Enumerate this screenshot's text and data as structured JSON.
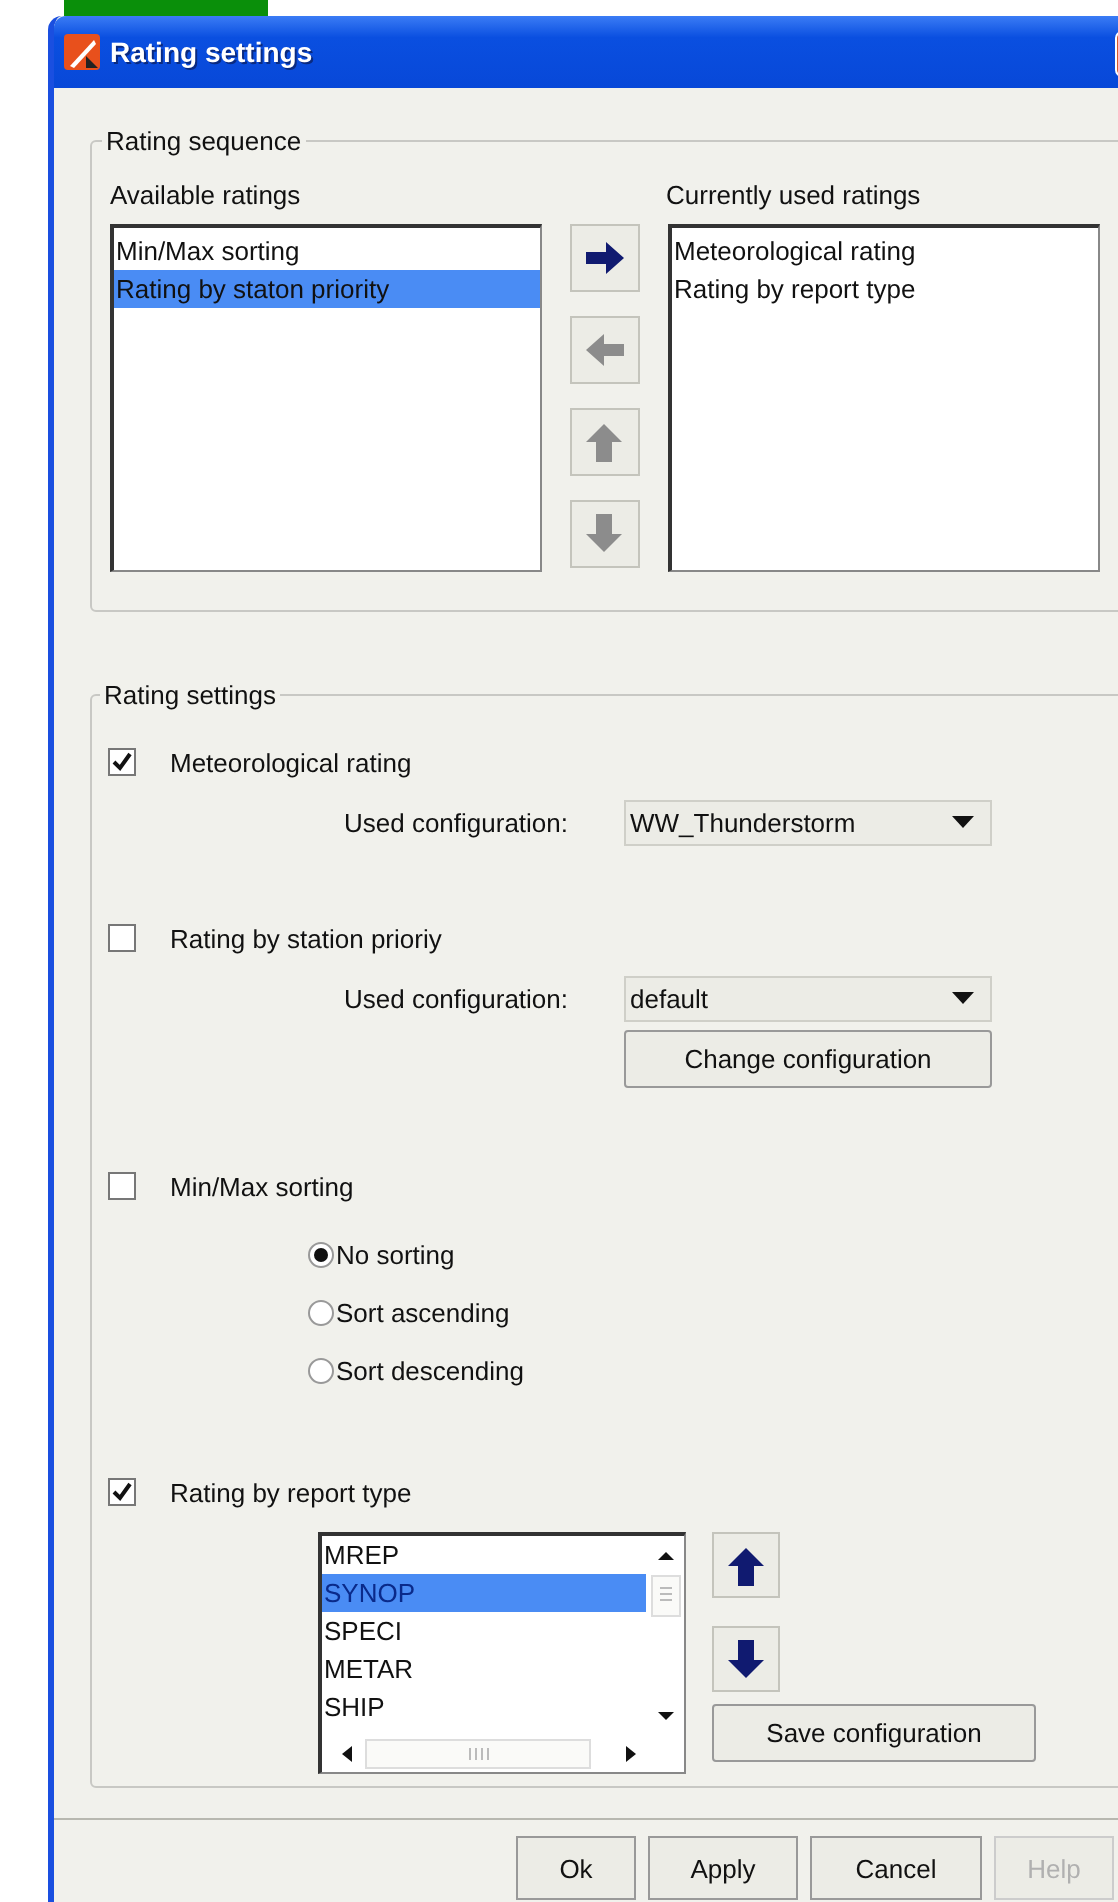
{
  "window": {
    "title": "Rating settings"
  },
  "rating_sequence": {
    "legend": "Rating sequence",
    "available_label": "Available ratings",
    "current_label": "Currently used ratings",
    "available": [
      {
        "label": "Min/Max sorting",
        "selected": false
      },
      {
        "label": "Rating by staton priority",
        "selected": true
      }
    ],
    "move_buttons": [
      {
        "kind": "right",
        "disabled": false
      },
      {
        "kind": "left",
        "disabled": true
      },
      {
        "kind": "up",
        "disabled": true
      },
      {
        "kind": "down",
        "disabled": true
      }
    ],
    "current": [
      {
        "label": "Meteorological rating",
        "selected": false
      },
      {
        "label": "Rating by report type",
        "selected": false
      }
    ]
  },
  "rating_settings": {
    "legend": "Rating settings",
    "options": [
      {
        "kind": "config",
        "label": "Meteorological rating",
        "checked": true,
        "config_label": "Used configuration:",
        "config_value": "WW_Thunderstorm"
      },
      {
        "kind": "config",
        "label": "Rating by station prioriy",
        "checked": false,
        "config_label": "Used configuration:",
        "config_value": "default",
        "button": "Change configuration"
      },
      {
        "kind": "sort",
        "label": "Min/Max sorting",
        "checked": false,
        "radios": [
          {
            "label": "No sorting",
            "selected": true
          },
          {
            "label": "Sort ascending",
            "selected": false
          },
          {
            "label": "Sort descending",
            "selected": false
          }
        ]
      },
      {
        "kind": "report",
        "label": "Rating by report type",
        "checked": true,
        "items": [
          {
            "label": "MREP",
            "selected": false
          },
          {
            "label": "SYNOP",
            "selected": true
          },
          {
            "label": "SPECI",
            "selected": false
          },
          {
            "label": "METAR",
            "selected": false
          },
          {
            "label": "SHIP",
            "selected": false
          }
        ],
        "move_buttons": [
          {
            "kind": "up",
            "disabled": false
          },
          {
            "kind": "down",
            "disabled": false
          }
        ],
        "button": "Save configuration"
      }
    ]
  },
  "footer_buttons": [
    {
      "label": "Ok",
      "disabled": false
    },
    {
      "label": "Apply",
      "disabled": false
    },
    {
      "label": "Cancel",
      "disabled": false
    },
    {
      "label": "Help",
      "disabled": true
    }
  ]
}
